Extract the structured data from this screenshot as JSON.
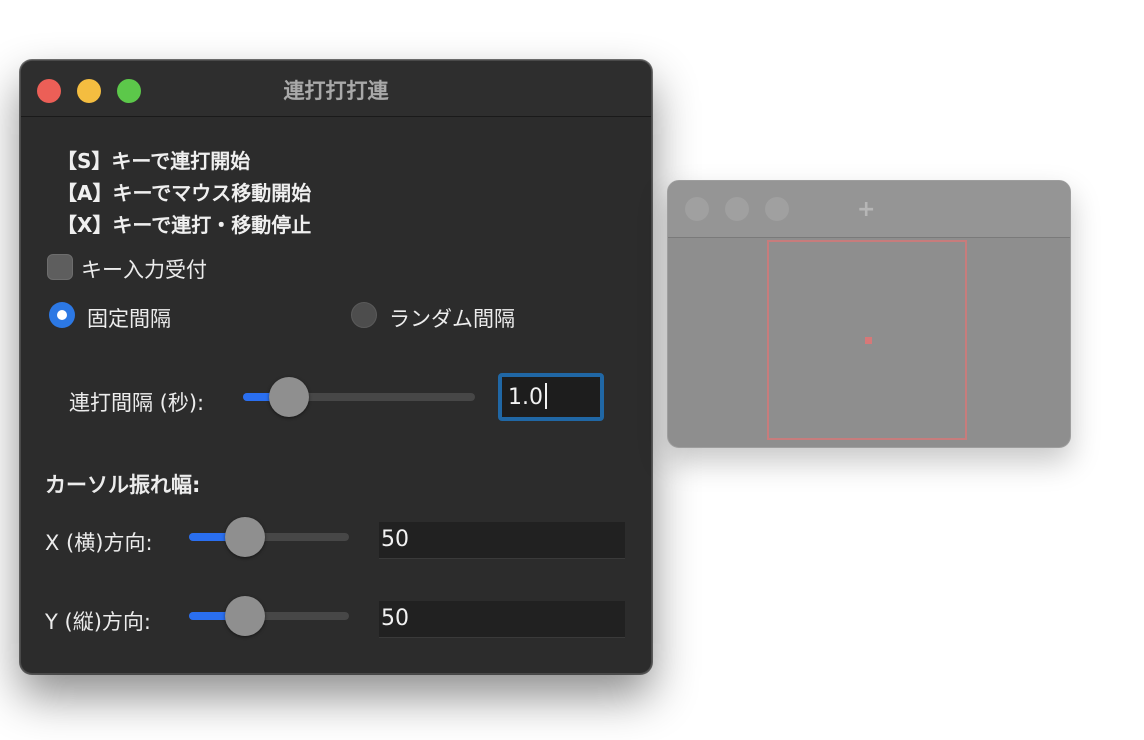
{
  "window": {
    "title": "連打打打連"
  },
  "instructions": [
    "【S】キーで連打開始",
    "【A】キーでマウス移動開始",
    "【X】キーで連打・移動停止"
  ],
  "key_input": {
    "label": "キー入力受付",
    "checked": false
  },
  "mode": {
    "options": [
      {
        "label": "固定間隔",
        "selected": true
      },
      {
        "label": "ランダム間隔",
        "selected": false
      }
    ]
  },
  "interval": {
    "label": "連打間隔 (秒):",
    "value": "1.0",
    "slider_fraction": 0.2
  },
  "cursor_amplitude": {
    "heading": "カーソル振れ幅:",
    "x": {
      "label": "X (横)方向:",
      "value": "50",
      "slider_fraction": 0.35
    },
    "y": {
      "label": "Y (縦)方向:",
      "value": "50",
      "slider_fraction": 0.35
    }
  },
  "preview_window": {
    "plus": "+"
  },
  "colors": {
    "accent": "#2a6ff0",
    "focus_ring": "#2067a5",
    "window_bg": "#2c2c2c",
    "target_outline": "#c77c7c"
  }
}
